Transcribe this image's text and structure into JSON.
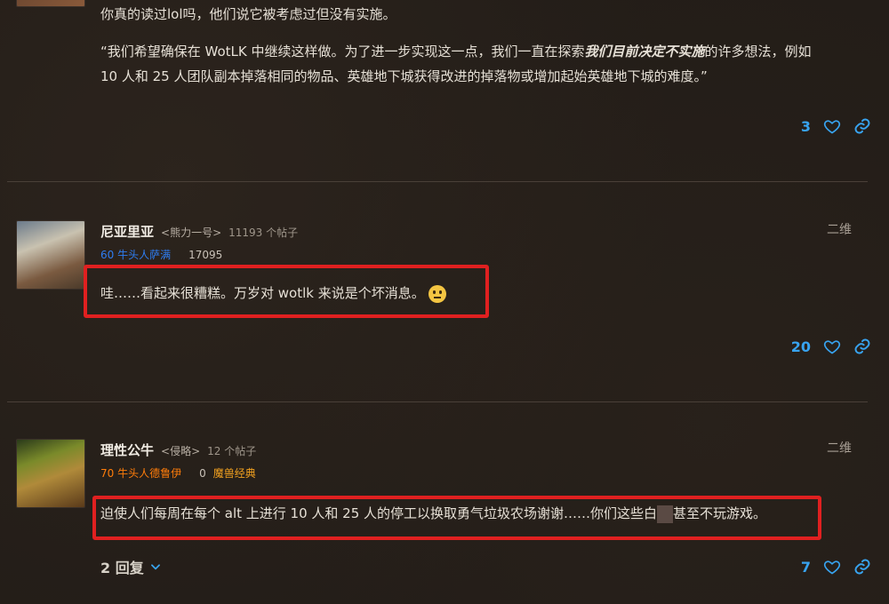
{
  "post1": {
    "line1": "你真的读过lol吗，他们说它被考虑过但没有实施。",
    "quote_a": "“我们希望确保在 WotLK 中继续这样做。为了进一步实现这一点，我们一直在探索",
    "quote_bold": "我们目前决定不实施",
    "quote_b": "的许多想法，例如",
    "quote_line3": "10 人和 25 人团队副本掉落相同的物品、英雄地下城获得改进的掉落物或增加起始英雄地下城的难度。”",
    "likes": "3"
  },
  "post2": {
    "username": "尼亚里亚",
    "title": "<熊力一号>",
    "post_count": "11193 个帖子",
    "char_info": "60 牛头人萨满",
    "score": "17095",
    "date": "二维",
    "body": "哇……看起来很糟糕。万岁对 wotlk 来说是个坏消息。",
    "likes": "20"
  },
  "post3": {
    "username": "理性公牛",
    "title": "<侵略>",
    "post_count": "12 个帖子",
    "char_info": "70 牛头人德鲁伊",
    "score": "0",
    "realm": "魔兽经典",
    "date": "二维",
    "body_a": "迫使人们每周在每个 alt 上进行 10 人和 25 人的停工以换取勇气垃圾农场谢谢……你们这些白",
    "body_b": "甚至不玩游戏。",
    "replies": "2 回复",
    "likes": "7"
  },
  "colors": {
    "accent_blue": "#38a3ef",
    "shaman_blue": "#2e7df2",
    "druid_orange": "#ff7d0a",
    "highlight_red": "#e02020"
  },
  "icons": {
    "like": "heart-icon",
    "link": "link-icon",
    "expand": "chevron-down-icon"
  }
}
